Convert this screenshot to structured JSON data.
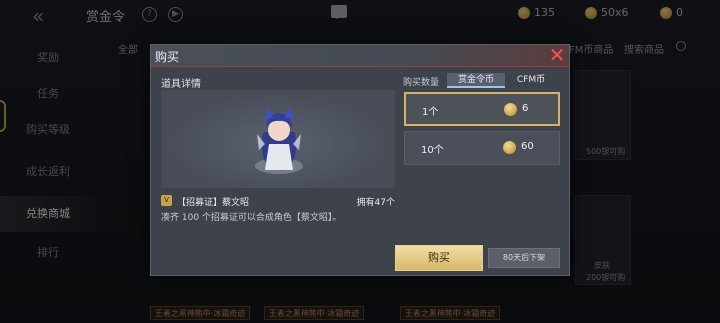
{
  "header": {
    "title": "赏金令",
    "currencies": [
      {
        "name": "coin-gold",
        "amount": "135"
      },
      {
        "name": "coin-orange",
        "amount": "50x6"
      },
      {
        "name": "coin-token",
        "amount": "0"
      }
    ]
  },
  "sidebar": {
    "items": [
      {
        "label": "奖励"
      },
      {
        "label": "任务"
      },
      {
        "label": "购买等级"
      },
      {
        "label": "成长返利"
      },
      {
        "label": "兑换商城"
      },
      {
        "label": "排行"
      }
    ],
    "active_index": 4
  },
  "background_tabs": {
    "all": "全部",
    "cfm_store": "CFM币商品",
    "search": "搜索商品"
  },
  "background_cards": {
    "count_1": "500银可购",
    "count_2": "200银可购",
    "skin": "皮肤",
    "strip_1": "王者之黑神熊中·冰霜奇迹",
    "strip_2": "王者之黑神熊中·冰霜奇迹",
    "strip_3": "王者之黑神熊中·冰霜奇迹"
  },
  "dialog": {
    "title": "购买",
    "section_label": "道具详情",
    "item_badge": "V",
    "item_name": "【招募证】蔡文昭",
    "owned": "拥有47个",
    "description": "凑齐 100 个招募证可以合成角色【蔡文昭】。",
    "quantity_label": "购买数量",
    "currency_tabs": [
      "赏金令币",
      "CFM币"
    ],
    "active_tab": 0,
    "options": [
      {
        "qty": "1个",
        "price": "6",
        "selected": true
      },
      {
        "qty": "10个",
        "price": "60",
        "selected": false
      }
    ],
    "buy_label": "购买",
    "expire_label": "80天后下架"
  },
  "colors": {
    "accent_gold": "#d6b26a",
    "close_red": "#ff4d4d",
    "dialog_bg": "#3d424b"
  }
}
